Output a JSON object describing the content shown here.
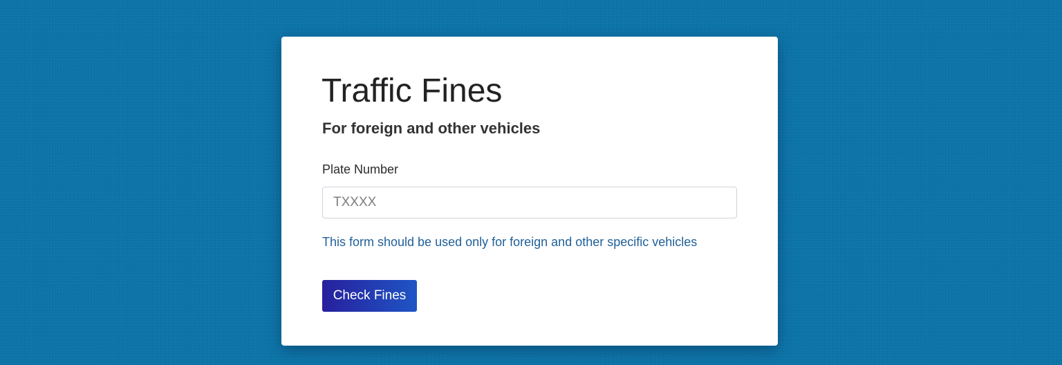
{
  "form": {
    "title": "Traffic Fines",
    "subtitle": "For foreign and other vehicles",
    "plate_label": "Plate Number",
    "plate_placeholder": "TXXXX",
    "plate_value": "",
    "help_text": "This form should be used only for foreign and other specific vehicles",
    "submit_label": "Check Fines"
  },
  "colors": {
    "page_background": "#0d74a8",
    "help_text": "#1f5f99",
    "button_gradient_start": "#27209d",
    "button_gradient_end": "#1f55c5"
  }
}
